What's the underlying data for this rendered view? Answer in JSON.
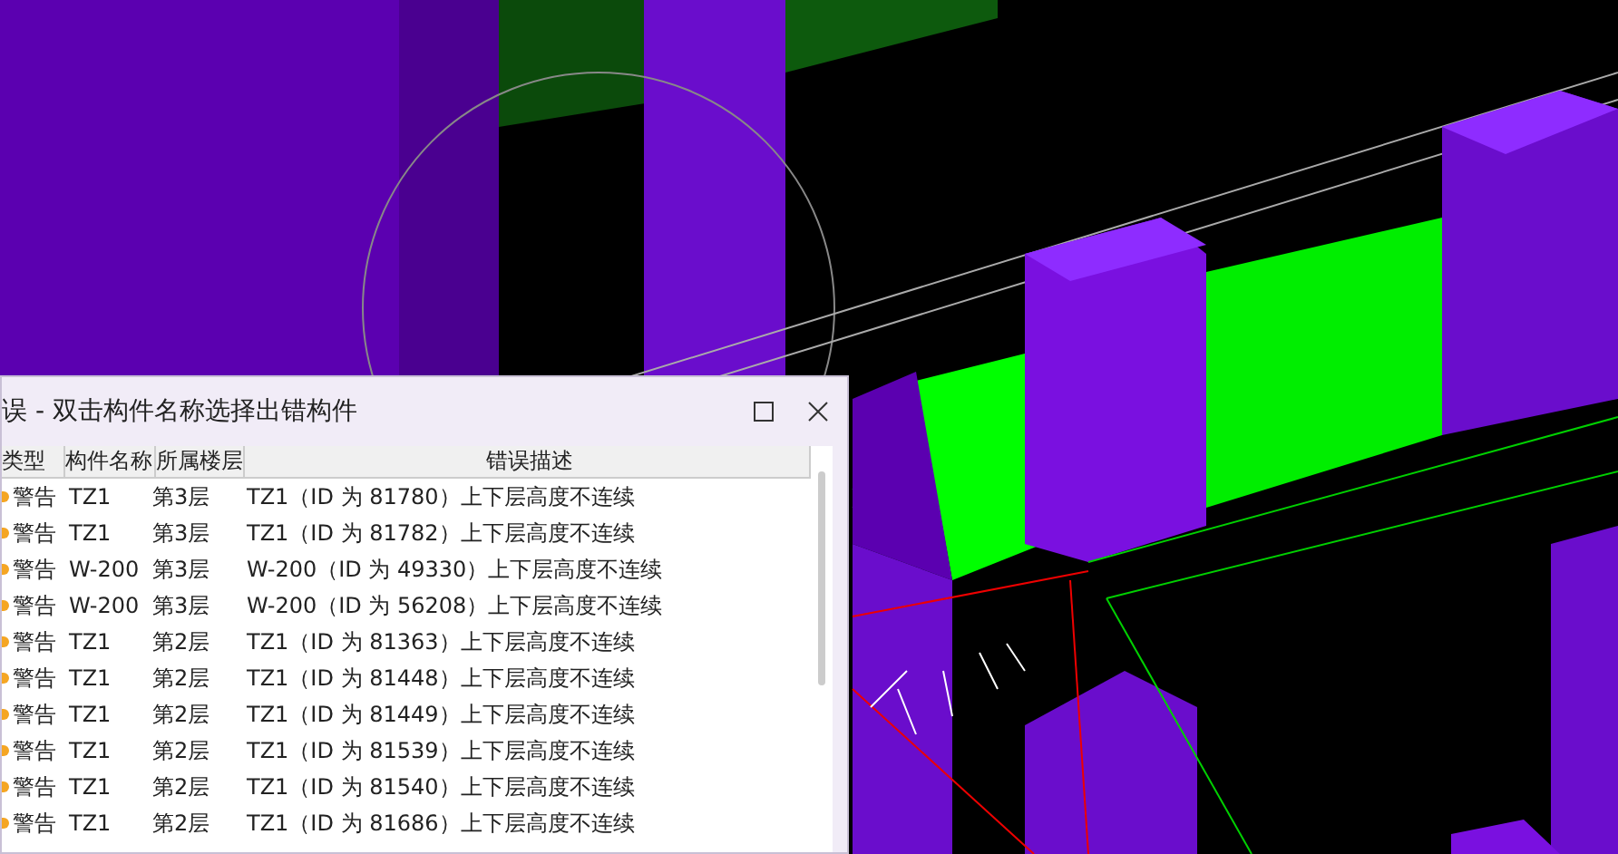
{
  "dialog": {
    "title": "误 - 双击构件名称选择出错构件",
    "columns": [
      "类型",
      "构件名称",
      "所属楼层",
      "错误描述"
    ],
    "rows": [
      {
        "type": "警告",
        "name": "TZ1",
        "floor": "第3层",
        "description": "TZ1（ID 为 81780）上下层高度不连续"
      },
      {
        "type": "警告",
        "name": "TZ1",
        "floor": "第3层",
        "description": "TZ1（ID 为 81782）上下层高度不连续"
      },
      {
        "type": "警告",
        "name": "W-200",
        "floor": "第3层",
        "description": "W-200（ID 为 49330）上下层高度不连续"
      },
      {
        "type": "警告",
        "name": "W-200",
        "floor": "第3层",
        "description": "W-200（ID 为 56208）上下层高度不连续"
      },
      {
        "type": "警告",
        "name": "TZ1",
        "floor": "第2层",
        "description": "TZ1（ID 为 81363）上下层高度不连续"
      },
      {
        "type": "警告",
        "name": "TZ1",
        "floor": "第2层",
        "description": "TZ1（ID 为 81448）上下层高度不连续"
      },
      {
        "type": "警告",
        "name": "TZ1",
        "floor": "第2层",
        "description": "TZ1（ID 为 81449）上下层高度不连续"
      },
      {
        "type": "警告",
        "name": "TZ1",
        "floor": "第2层",
        "description": "TZ1（ID 为 81539）上下层高度不连续"
      },
      {
        "type": "警告",
        "name": "TZ1",
        "floor": "第2层",
        "description": "TZ1（ID 为 81540）上下层高度不连续"
      },
      {
        "type": "警告",
        "name": "TZ1",
        "floor": "第2层",
        "description": "TZ1（ID 为 81686）上下层高度不连续"
      }
    ]
  }
}
